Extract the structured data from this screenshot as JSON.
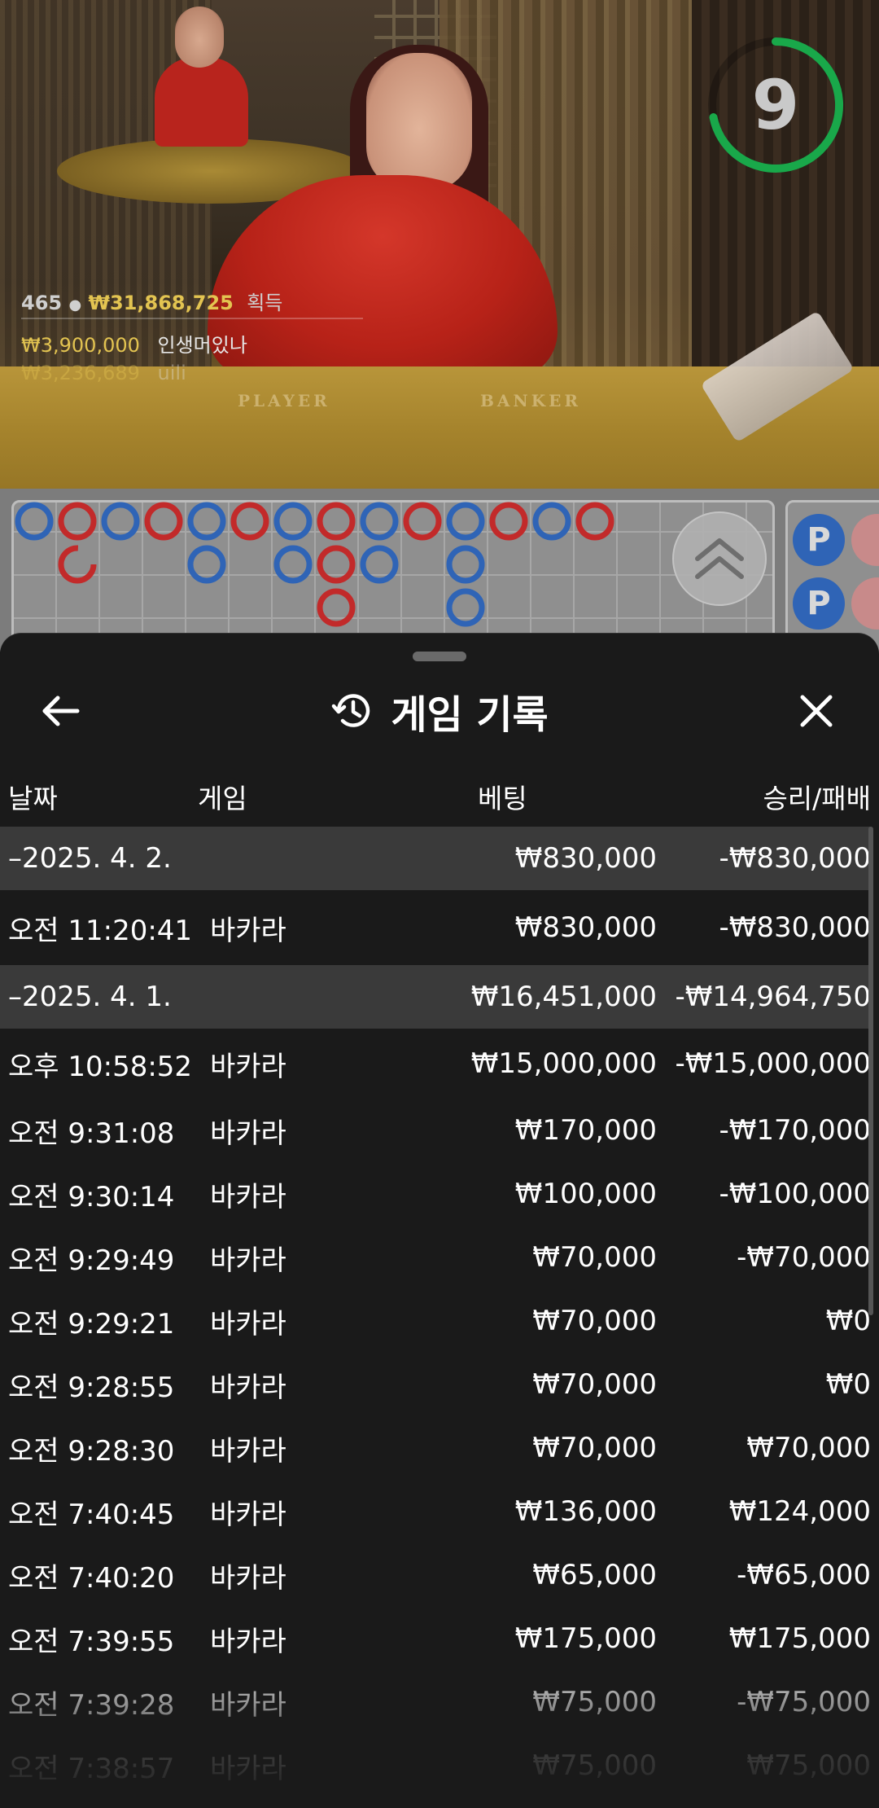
{
  "video": {
    "countdown": "9",
    "winners": {
      "count": "465",
      "amount": "₩31,868,725",
      "label": "획득"
    },
    "win_feed": [
      {
        "amount": "₩3,900,000",
        "name": "인생머있나"
      },
      {
        "amount": "₩3,236,689",
        "name": "uili"
      }
    ],
    "table_labels": {
      "player": "PLAYER",
      "banker": "BANKER"
    },
    "colors": {
      "timer": "#19a84a",
      "gold": "#e3c451"
    }
  },
  "roadmap": {
    "player_symbol": "P",
    "colors": {
      "player": "#2f64b6",
      "banker": "#c22a2a"
    },
    "beads": [
      {
        "col": 0,
        "row": 0,
        "side": "player"
      },
      {
        "col": 1,
        "row": 0,
        "side": "banker"
      },
      {
        "col": 1,
        "row": 1,
        "side": "banker-partial"
      },
      {
        "col": 2,
        "row": 0,
        "side": "player"
      },
      {
        "col": 3,
        "row": 0,
        "side": "banker"
      },
      {
        "col": 4,
        "row": 0,
        "side": "player"
      },
      {
        "col": 4,
        "row": 1,
        "side": "player"
      },
      {
        "col": 5,
        "row": 0,
        "side": "banker"
      },
      {
        "col": 6,
        "row": 0,
        "side": "player"
      },
      {
        "col": 6,
        "row": 1,
        "side": "player"
      },
      {
        "col": 7,
        "row": 0,
        "side": "banker"
      },
      {
        "col": 7,
        "row": 1,
        "side": "banker"
      },
      {
        "col": 7,
        "row": 2,
        "side": "banker"
      },
      {
        "col": 8,
        "row": 0,
        "side": "player"
      },
      {
        "col": 8,
        "row": 1,
        "side": "player"
      },
      {
        "col": 9,
        "row": 0,
        "side": "banker"
      },
      {
        "col": 10,
        "row": 0,
        "side": "player"
      },
      {
        "col": 10,
        "row": 1,
        "side": "player"
      },
      {
        "col": 10,
        "row": 2,
        "side": "player"
      },
      {
        "col": 11,
        "row": 0,
        "side": "banker"
      },
      {
        "col": 12,
        "row": 0,
        "side": "player"
      },
      {
        "col": 13,
        "row": 0,
        "side": "banker"
      }
    ]
  },
  "sheet": {
    "title": "게임 기록",
    "icons": {
      "back": "arrow-left-icon",
      "history": "history-icon",
      "close": "close-icon"
    },
    "columns": {
      "date": "날짜",
      "game": "게임",
      "bet": "베팅",
      "win_loss": "승리/패배"
    },
    "groups": [
      {
        "date": "–2025. 4. 2.",
        "bet": "₩830,000",
        "win_loss": "-₩830,000",
        "rows": [
          {
            "time": "오전 11:20:41",
            "game": "바카라",
            "bet": "₩830,000",
            "win_loss": "-₩830,000"
          }
        ]
      },
      {
        "date": "–2025. 4. 1.",
        "bet": "₩16,451,000",
        "win_loss": "-₩14,964,750",
        "rows": [
          {
            "time": "오후 10:58:52",
            "game": "바카라",
            "bet": "₩15,000,000",
            "win_loss": "-₩15,000,000"
          },
          {
            "time": "오전 9:31:08",
            "game": "바카라",
            "bet": "₩170,000",
            "win_loss": "-₩170,000"
          },
          {
            "time": "오전 9:30:14",
            "game": "바카라",
            "bet": "₩100,000",
            "win_loss": "-₩100,000"
          },
          {
            "time": "오전 9:29:49",
            "game": "바카라",
            "bet": "₩70,000",
            "win_loss": "-₩70,000"
          },
          {
            "time": "오전 9:29:21",
            "game": "바카라",
            "bet": "₩70,000",
            "win_loss": "₩0"
          },
          {
            "time": "오전 9:28:55",
            "game": "바카라",
            "bet": "₩70,000",
            "win_loss": "₩0"
          },
          {
            "time": "오전 9:28:30",
            "game": "바카라",
            "bet": "₩70,000",
            "win_loss": "₩70,000"
          },
          {
            "time": "오전 7:40:45",
            "game": "바카라",
            "bet": "₩136,000",
            "win_loss": "₩124,000"
          },
          {
            "time": "오전 7:40:20",
            "game": "바카라",
            "bet": "₩65,000",
            "win_loss": "-₩65,000"
          },
          {
            "time": "오전 7:39:55",
            "game": "바카라",
            "bet": "₩175,000",
            "win_loss": "₩175,000"
          },
          {
            "time": "오전 7:39:28",
            "game": "바카라",
            "bet": "₩75,000",
            "win_loss": "-₩75,000"
          },
          {
            "time": "오전 7:38:57",
            "game": "바카라",
            "bet": "₩75,000",
            "win_loss": "₩75,000"
          }
        ]
      }
    ]
  }
}
